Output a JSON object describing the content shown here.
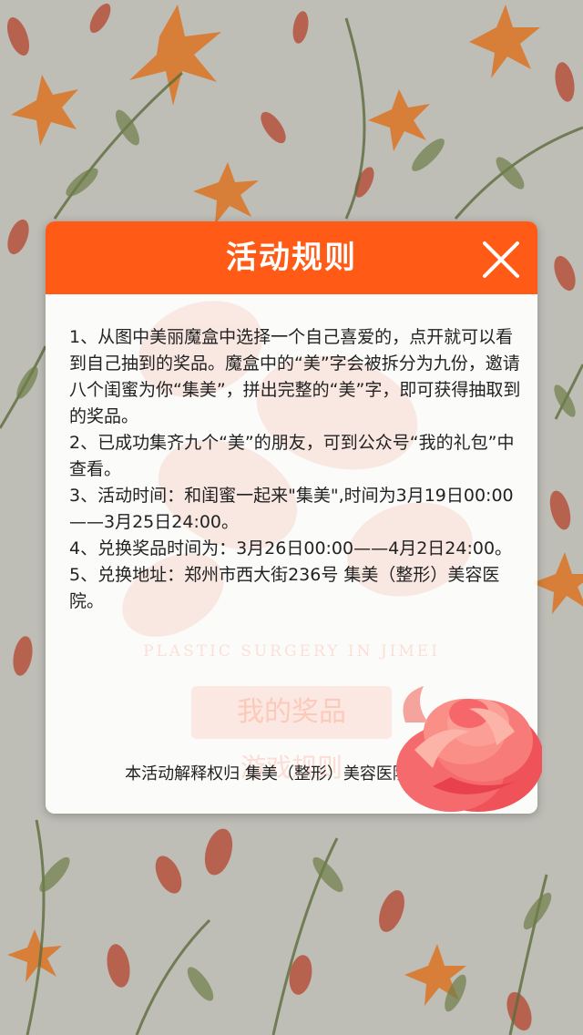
{
  "modal": {
    "title": "活动规则",
    "rules": [
      "1、从图中美丽魔盒中选择一个自己喜爱的，点开就可以看到自己抽到的奖品。魔盒中的“美”字会被拆分为九份，邀请八个闺蜜为你“集美”，拼出完整的“美”字，即可获得抽取到的奖品。",
      "2、已成功集齐九个“美”的朋友，可到公众号“我的礼包”中查看。",
      "3、活动时间：和闺蜜一起来\"集美\",时间为3月19日00:00——3月25日24:00。",
      "4、兑换奖品时间为：3月26日00:00——4月2日24:00。",
      "5、兑换地址：郑州市西大街236号 集美（整形）美容医院。"
    ],
    "footer": "本活动解释权归 集美（整形）美容医院所有。"
  },
  "background_page": {
    "tagline": "PLASTIC SURGERY IN JIMEI",
    "prize_button": "我的奖品",
    "game_rules_button": "游戏规则"
  },
  "colors": {
    "header": "#ff5a16",
    "title_text": "#ffffff",
    "body_text": "#222222"
  },
  "icons": {
    "close": "close-icon",
    "decor": "peony-flower-decoration"
  }
}
